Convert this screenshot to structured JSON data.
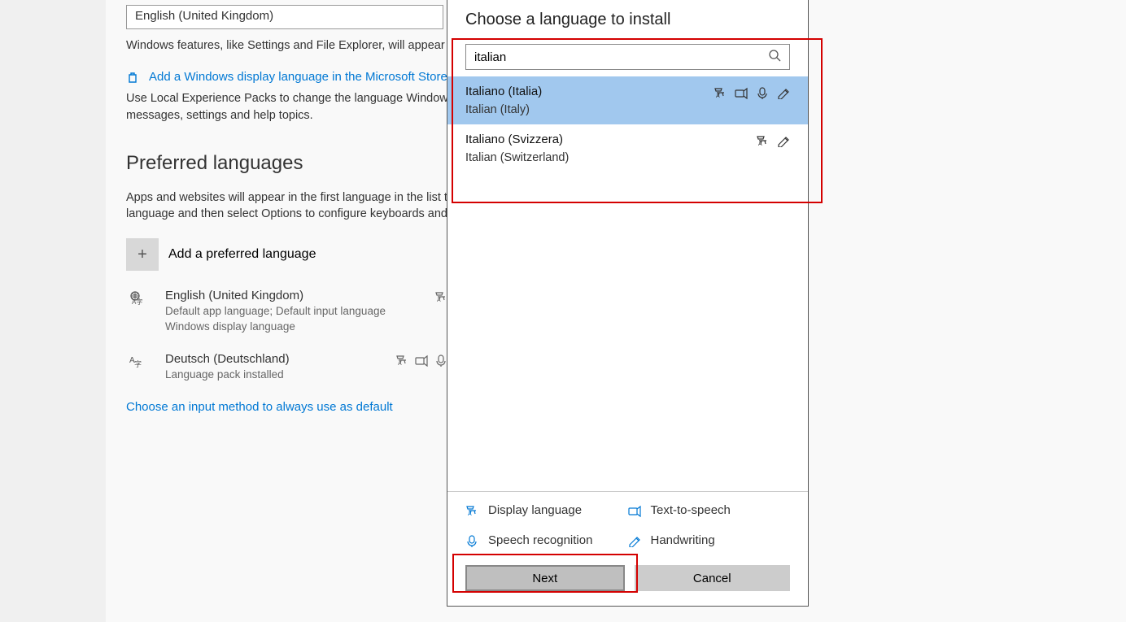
{
  "settings": {
    "current_language": "English (United Kingdom)",
    "features_desc": "Windows features, like Settings and File Explorer, will appear in this language.",
    "store_link": "Add a Windows display language in the Microsoft Store",
    "local_packs_desc": "Use Local Experience Packs to change the language Windows uses for navigation, menus, messages, settings and help topics.",
    "preferred_title": "Preferred languages",
    "preferred_desc": "Apps and websites will appear in the first language in the list that they support. Select a language and then select Options to configure keyboards and other features.",
    "add_label": "Add a preferred language",
    "languages": [
      {
        "name": "English (United Kingdom)",
        "sub": "Default app language; Default input language\nWindows display language"
      },
      {
        "name": "Deutsch (Deutschland)",
        "sub": "Language pack installed"
      }
    ],
    "input_method_link": "Choose an input method to always use as default"
  },
  "dialog": {
    "title": "Choose a language to install",
    "search_value": "italian",
    "results": [
      {
        "native": "Italiano (Italia)",
        "english": "Italian (Italy)",
        "selected": true,
        "features": [
          "display",
          "tts",
          "speech",
          "hw"
        ]
      },
      {
        "native": "Italiano (Svizzera)",
        "english": "Italian (Switzerland)",
        "selected": false,
        "features": [
          "display",
          "hw"
        ]
      }
    ],
    "legend": {
      "display": "Display language",
      "tts": "Text-to-speech",
      "speech": "Speech recognition",
      "hw": "Handwriting"
    },
    "next": "Next",
    "cancel": "Cancel"
  }
}
